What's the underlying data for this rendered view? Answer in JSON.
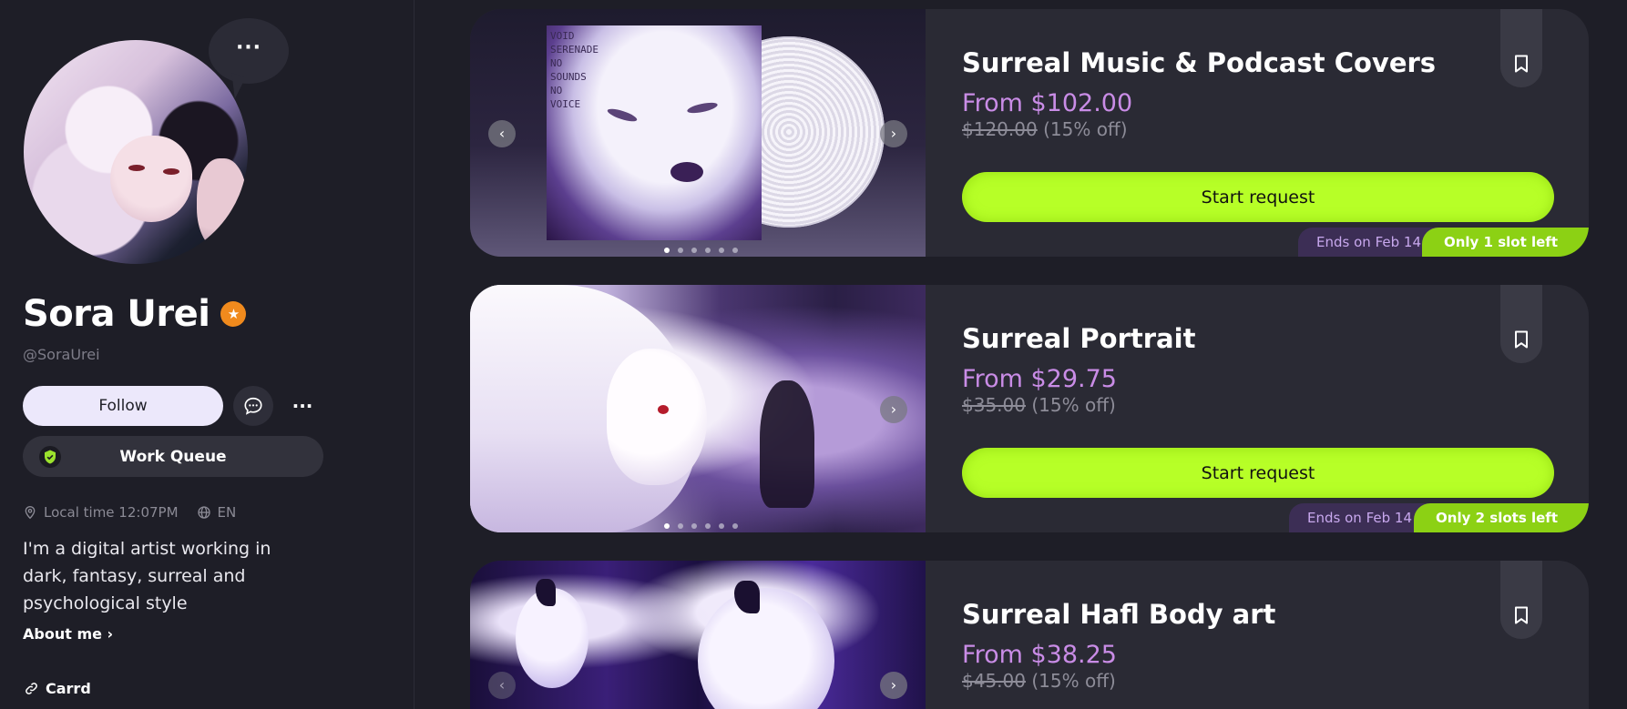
{
  "profile": {
    "name": "Sora Urei",
    "handle": "@SoraUrei",
    "more_bubble": "···",
    "follow_label": "Follow",
    "more_label": "···",
    "work_queue_label": "Work Queue",
    "local_time": "Local time 12:07PM",
    "language": "EN",
    "bio": "I'm a digital artist working in dark, fantasy, surreal and psychological style",
    "about_label": "About me ›",
    "link_label": "Carrd"
  },
  "album_text": "VOID\nSERENADE\nNO\nSOUNDS\nNO\nVOICE",
  "cards": [
    {
      "title": "Surreal Music & Podcast Covers",
      "price": "From $102.00",
      "original_price": "$120.00",
      "discount": "(15% off)",
      "button": "Start request",
      "ends": "Ends on Feb 14",
      "slots": "Only 1 slot left"
    },
    {
      "title": "Surreal Portrait",
      "price": "From $29.75",
      "original_price": "$35.00",
      "discount": "(15% off)",
      "button": "Start request",
      "ends": "Ends on Feb 14",
      "slots": "Only 2 slots left"
    },
    {
      "title": "Surreal Hafl Body art",
      "price": "From $38.25",
      "original_price": "$45.00",
      "discount": "(15% off)"
    }
  ],
  "carousel": {
    "image_count": 6,
    "active_index": 0
  },
  "colors": {
    "background": "#1e1e27",
    "card": "#2a2a34",
    "accent_green": "#b7ff27",
    "price_purple": "#c98ce6",
    "verified_orange": "#f08a1d"
  }
}
